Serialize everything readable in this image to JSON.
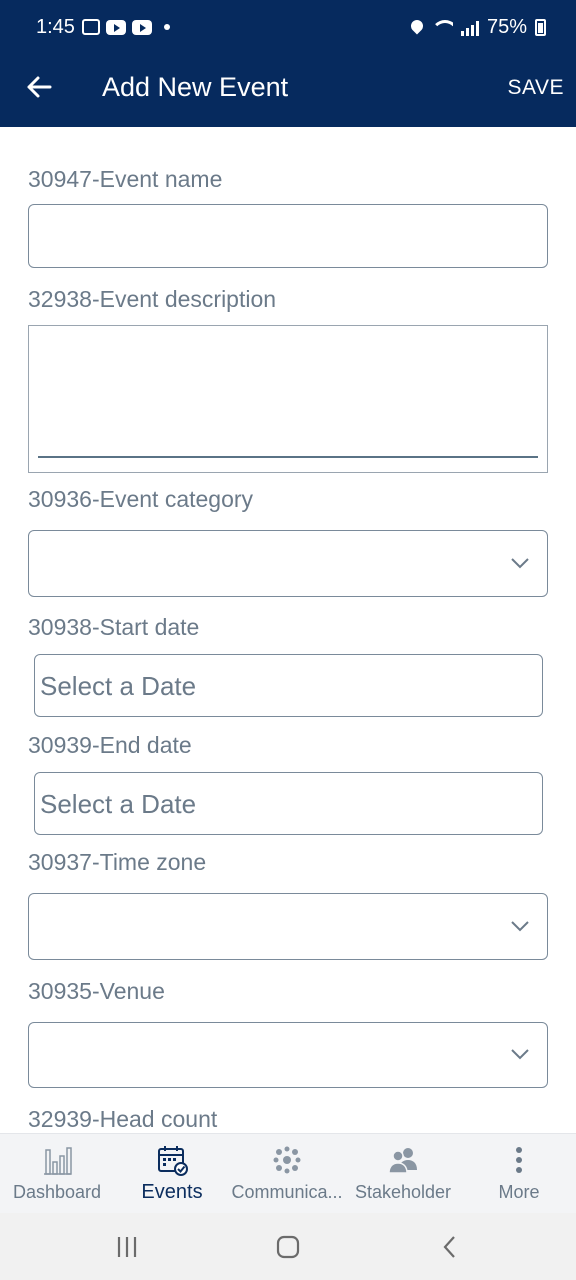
{
  "status_bar": {
    "time": "1:45",
    "battery": "75%"
  },
  "appbar": {
    "title": "Add New Event",
    "save_label": "SAVE",
    "back_icon": "arrow-left-icon"
  },
  "form": {
    "event_name": {
      "label": "30947-Event name",
      "value": ""
    },
    "event_description": {
      "label": "32938-Event description",
      "value": ""
    },
    "event_category": {
      "label": "30936-Event category",
      "value": ""
    },
    "start_date": {
      "label": "30938-Start date",
      "placeholder": "Select a Date"
    },
    "end_date": {
      "label": "30939-End date",
      "placeholder": "Select a Date"
    },
    "time_zone": {
      "label": "30937-Time zone",
      "value": ""
    },
    "venue": {
      "label": "30935-Venue",
      "value": ""
    },
    "head_count": {
      "label": "32939-Head count"
    }
  },
  "bottom_nav": {
    "items": [
      {
        "label": "Dashboard",
        "icon": "bar-chart-icon"
      },
      {
        "label": "Events",
        "icon": "calendar-check-icon"
      },
      {
        "label": "Communica...",
        "icon": "network-dots-icon"
      },
      {
        "label": "Stakeholder",
        "icon": "people-icon"
      },
      {
        "label": "More",
        "icon": "more-vertical-icon"
      }
    ],
    "active_index": 1
  },
  "colors": {
    "appbar": "#062a5e",
    "active_nav": "#0b2d5e",
    "label": "#6b7a89"
  }
}
